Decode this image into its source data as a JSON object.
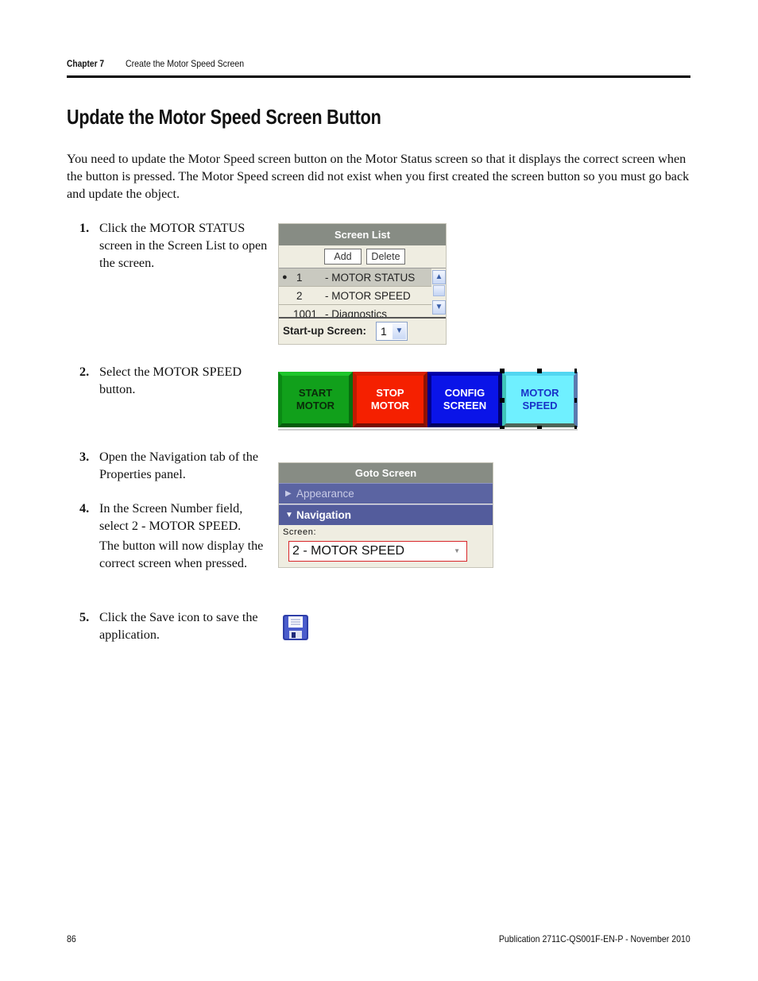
{
  "header": {
    "chapter": "Chapter 7",
    "chapter_title": "Create the Motor Speed Screen"
  },
  "page_title": "Update the Motor Speed Screen Button",
  "intro": "You need to update the Motor Speed screen button on the Motor Status screen so that it displays the correct screen when the button is pressed. The Motor Speed screen did not exist when you first created the screen button so you must go back and update the object.",
  "steps": [
    {
      "num": "1.",
      "text": "Click the MOTOR STATUS screen in the Screen List to open the screen."
    },
    {
      "num": "2.",
      "text": "Select the MOTOR SPEED button."
    },
    {
      "num": "3.",
      "text": "Open the Navigation tab of the Properties panel."
    },
    {
      "num": "4.",
      "text": "In the Screen Number field, select 2 - MOTOR SPEED.",
      "note": "The button will now display the correct screen when pressed."
    },
    {
      "num": "5.",
      "text": "Click the Save icon to save the application."
    }
  ],
  "screen_list": {
    "title": "Screen List",
    "add_label": "Add",
    "delete_label": "Delete",
    "items": [
      {
        "bullet": "●",
        "number": "1",
        "name": "- MOTOR STATUS",
        "selected": true
      },
      {
        "bullet": "",
        "number": "2",
        "name": "- MOTOR SPEED",
        "selected": false
      },
      {
        "bullet": "",
        "number": "1001",
        "name": "- Diagnostics",
        "selected": false
      }
    ],
    "startup_label": "Start-up Screen:",
    "startup_value": "1",
    "scroll_up_icon": "chevron-up-icon",
    "scroll_down_icon": "chevron-down-icon"
  },
  "hmi_buttons": [
    {
      "line1": "START",
      "line2": "MOTOR",
      "color": "#11a01b"
    },
    {
      "line1": "STOP",
      "line2": "MOTOR",
      "color": "#f52000"
    },
    {
      "line1": "CONFIG",
      "line2": "SCREEN",
      "color": "#0a14e8"
    },
    {
      "line1": "MOTOR",
      "line2": "SPEED",
      "color": "#6ff0ff",
      "selected": true
    }
  ],
  "goto_screen": {
    "title": "Goto Screen",
    "sections": [
      {
        "label": "Appearance",
        "expanded": false
      },
      {
        "label": "Navigation",
        "expanded": true
      }
    ],
    "screen_label": "Screen:",
    "screen_value": "2 - MOTOR SPEED"
  },
  "save_icon": "floppy-disk-icon",
  "footer": {
    "page_number": "86",
    "publication": "Publication 2711C-QS001F-EN-P - November 2010"
  }
}
